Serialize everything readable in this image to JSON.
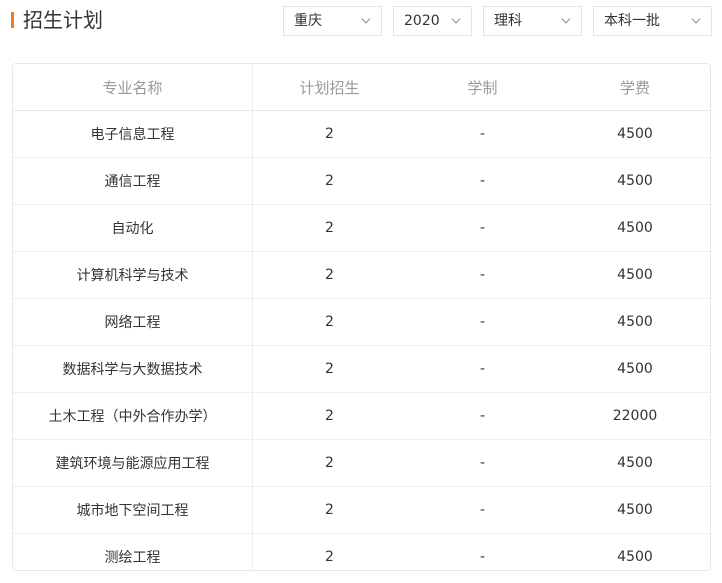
{
  "header": {
    "title": "招生计划"
  },
  "filters": [
    {
      "value": "重庆"
    },
    {
      "value": "2020"
    },
    {
      "value": "理科"
    },
    {
      "value": "本科一批"
    }
  ],
  "table": {
    "columns": [
      "专业名称",
      "计划招生",
      "学制",
      "学费"
    ],
    "rows": [
      [
        "电子信息工程",
        "2",
        "-",
        "4500"
      ],
      [
        "通信工程",
        "2",
        "-",
        "4500"
      ],
      [
        "自动化",
        "2",
        "-",
        "4500"
      ],
      [
        "计算机科学与技术",
        "2",
        "-",
        "4500"
      ],
      [
        "网络工程",
        "2",
        "-",
        "4500"
      ],
      [
        "数据科学与大数据技术",
        "2",
        "-",
        "4500"
      ],
      [
        "土木工程（中外合作办学）",
        "2",
        "-",
        "22000"
      ],
      [
        "建筑环境与能源应用工程",
        "2",
        "-",
        "4500"
      ],
      [
        "城市地下空间工程",
        "2",
        "-",
        "4500"
      ],
      [
        "测绘工程",
        "2",
        "-",
        "4500"
      ]
    ]
  },
  "colors": {
    "accent": "#f07a2a",
    "border": "#e8e8e8",
    "header_text": "#999999"
  },
  "icons": {
    "dropdown": "chevron-down-icon"
  }
}
